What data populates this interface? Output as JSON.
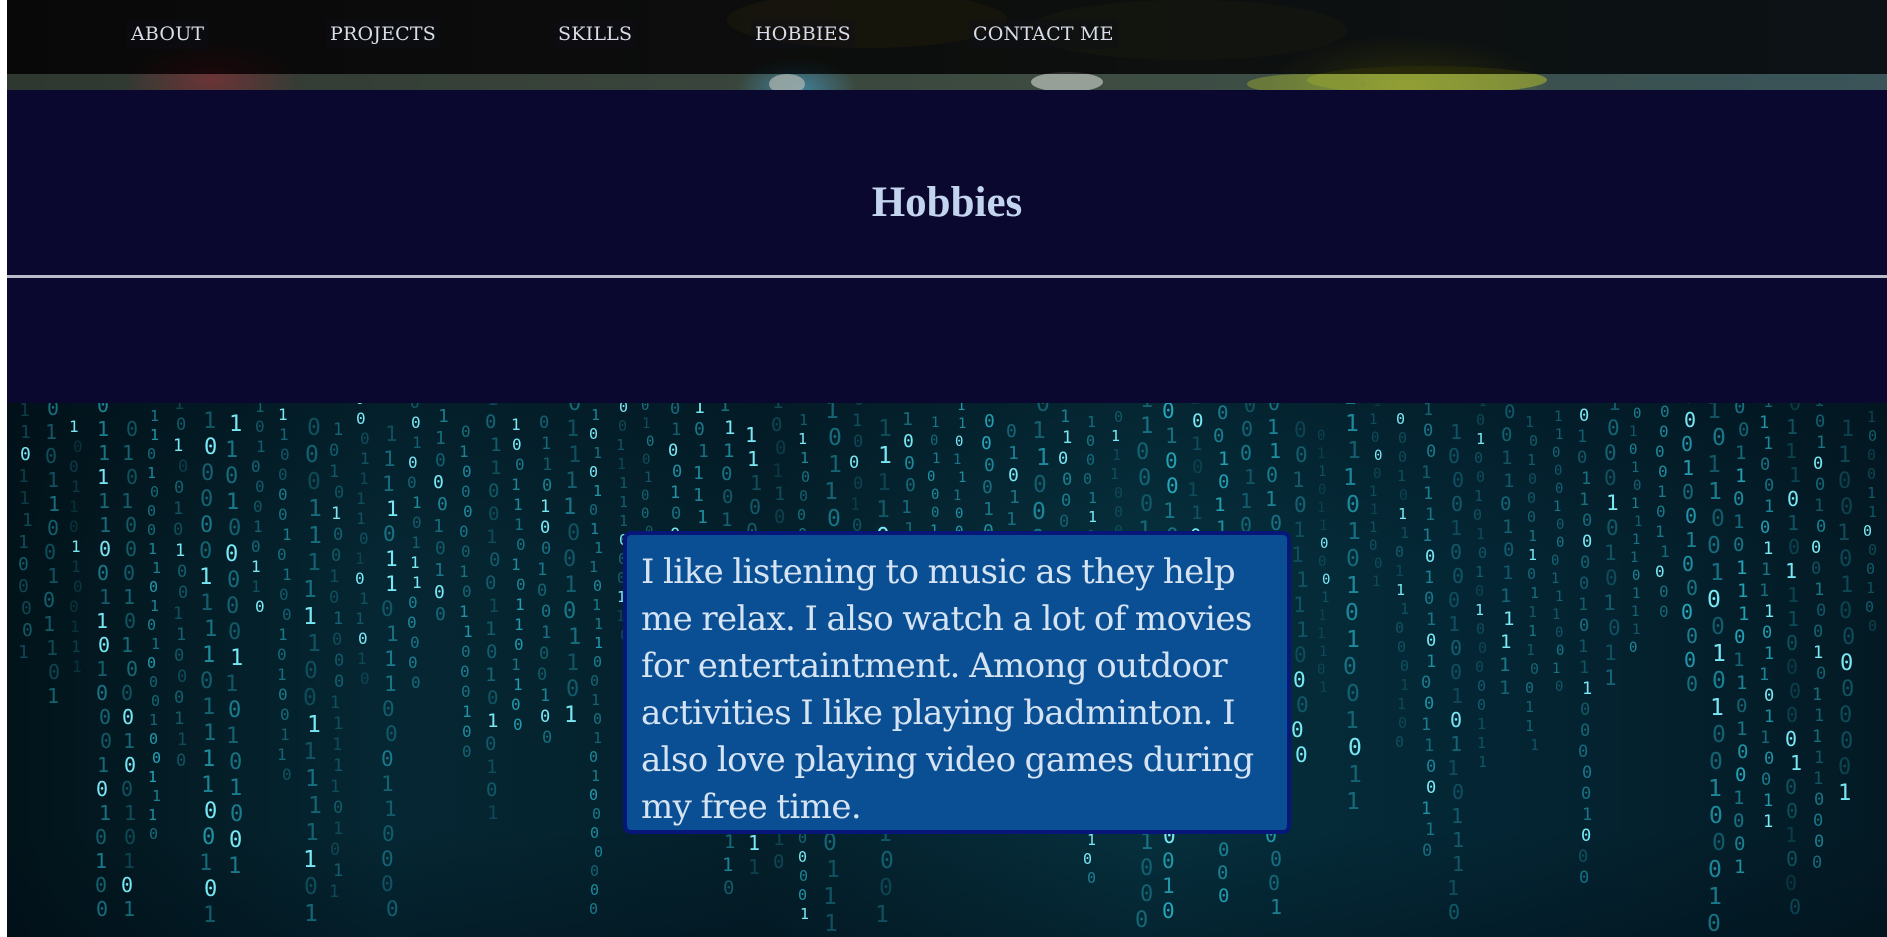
{
  "nav": {
    "items": [
      {
        "label": "ABOUT"
      },
      {
        "label": "PROJECTS"
      },
      {
        "label": "SKILLS"
      },
      {
        "label": "HOBBIES"
      },
      {
        "label": "CONTACT ME"
      }
    ]
  },
  "hobbies": {
    "title": "Hobbies",
    "description": "I like listening to music as they help me relax. I also watch a lot of movies for entertaintment. Among outdoor activities I like playing badminton. I also love playing video games during my free time."
  },
  "colors": {
    "page_background": "#0b0830",
    "title": "#c3d4ef",
    "card_background": "#0a4f93",
    "card_border": "#061779",
    "matrix_digits": "#2fd0e6"
  }
}
